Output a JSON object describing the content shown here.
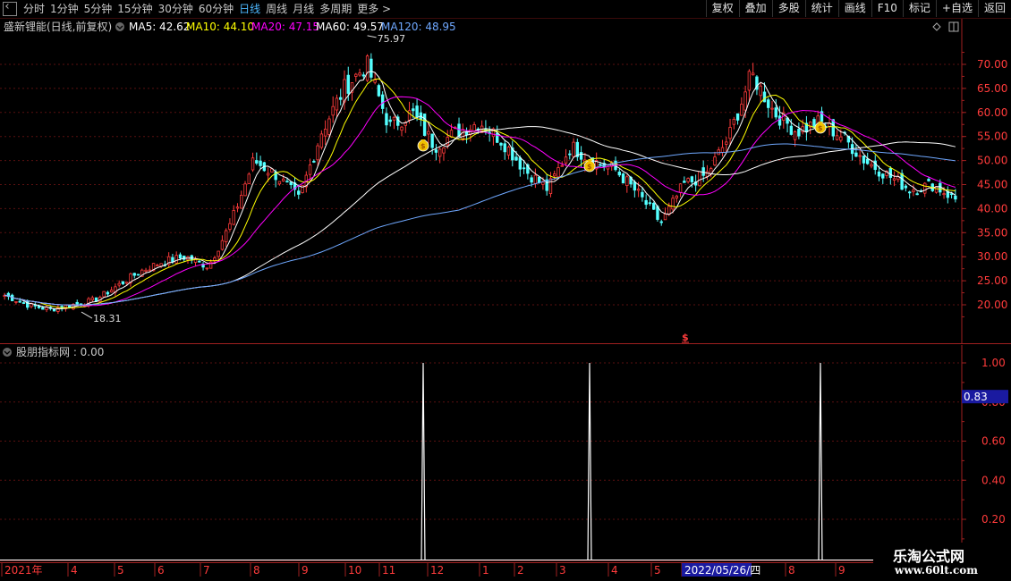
{
  "toolbar": {
    "periods": [
      {
        "label": "分时",
        "active": false
      },
      {
        "label": "1分钟",
        "active": false
      },
      {
        "label": "5分钟",
        "active": false
      },
      {
        "label": "15分钟",
        "active": false
      },
      {
        "label": "30分钟",
        "active": false
      },
      {
        "label": "60分钟",
        "active": false
      },
      {
        "label": "日线",
        "active": true
      },
      {
        "label": "周线",
        "active": false
      },
      {
        "label": "月线",
        "active": false
      },
      {
        "label": "多周期",
        "active": false
      },
      {
        "label": "更多",
        "active": false
      }
    ],
    "buttons": [
      "复权",
      "叠加",
      "多股",
      "统计",
      "画线",
      "F10",
      "标记",
      "+自选",
      "返回"
    ]
  },
  "main_header": {
    "title": "盛新锂能(日线,前复权)",
    "ma": [
      {
        "label": "MA5: 42.62",
        "color": "#ffffff"
      },
      {
        "label": "MA10: 44.10",
        "color": "#ffff00"
      },
      {
        "label": "MA20: 47.15",
        "color": "#ff00ff"
      },
      {
        "label": "MA60: 49.57",
        "color": "#ffffff"
      },
      {
        "label": "MA120: 48.95",
        "color": "#6fa8ff"
      }
    ]
  },
  "indicator_header": {
    "title": "股朋指标网 : 0.00"
  },
  "price_axis": {
    "ticks": [
      "70.00",
      "65.00",
      "60.00",
      "55.00",
      "50.00",
      "45.00",
      "40.00",
      "35.00",
      "30.00",
      "25.00",
      "20.00"
    ],
    "high_label": "75.97",
    "low_label": "18.31"
  },
  "indicator_axis": {
    "ticks": [
      "1.00",
      "0.80",
      "0.60",
      "0.40",
      "0.20"
    ],
    "cursor_value": "0.83"
  },
  "date_axis": {
    "labels": [
      "2021年",
      "4",
      "5",
      "6",
      "7",
      "8",
      "9",
      "10",
      "11",
      "12",
      "1",
      "2",
      "3",
      "4",
      "5",
      "2022/05/26/四",
      "8",
      "9"
    ]
  },
  "watermark": {
    "title": "乐淘公式网",
    "url": "www.60lt.com"
  },
  "chart_data": {
    "type": "candlestick",
    "symbol_title": "盛新锂能(日线,前复权)",
    "ylim": [
      15,
      80
    ],
    "high": 75.97,
    "low": 18.31,
    "ma_last": {
      "MA5": 42.62,
      "MA10": 44.1,
      "MA20": 47.15,
      "MA60": 49.57,
      "MA120": 48.95
    },
    "close_path_months": [
      "2021年",
      "4",
      "5",
      "6",
      "7",
      "8",
      "9",
      "10",
      "11",
      "12",
      "1",
      "2",
      "3",
      "4",
      "5",
      "2022/05/26/四",
      "8",
      "9"
    ],
    "close_keypoints": [
      22,
      20,
      19,
      20,
      21,
      24,
      27,
      29,
      30,
      28,
      37,
      50,
      47,
      42,
      56,
      65,
      70,
      57,
      60,
      53,
      56,
      58,
      54,
      48,
      44,
      53,
      50,
      48,
      43,
      37,
      45,
      47,
      55,
      68,
      60,
      56,
      58,
      55,
      50,
      47,
      44,
      45,
      42
    ],
    "indicator": {
      "name": "股朋指标网",
      "ylim": [
        0,
        1.1
      ],
      "spikes": [
        1.0,
        1.0,
        1.0
      ],
      "current": 0.0
    }
  }
}
